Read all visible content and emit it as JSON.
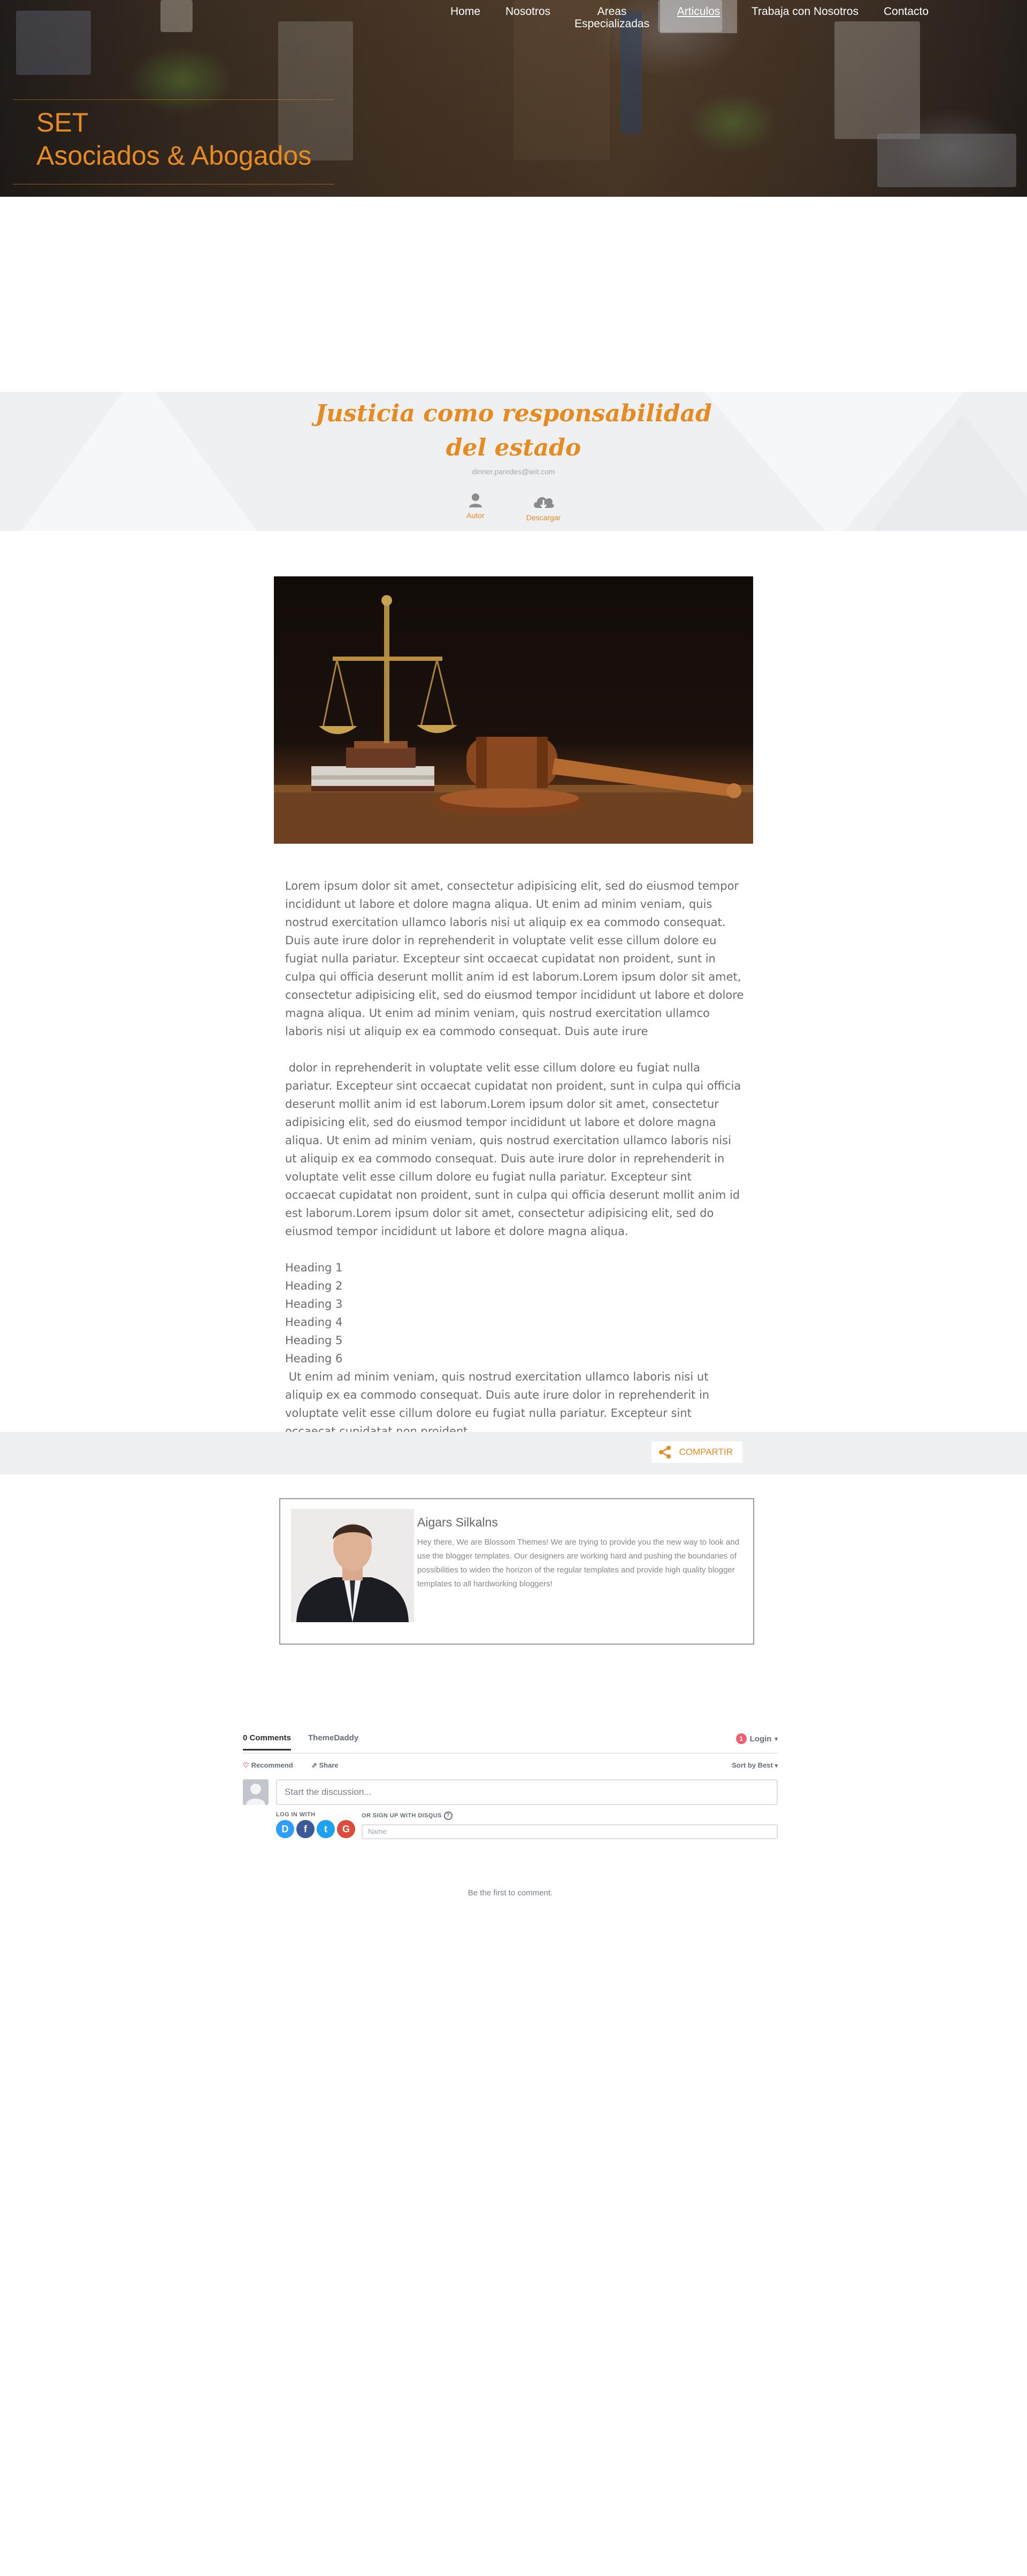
{
  "brand": {
    "line1": "SET",
    "line2": "Asociados & Abogados"
  },
  "nav": {
    "home": "Home",
    "about": "Nosotros",
    "areas_line1": "Areas",
    "areas_line2": "Especializadas",
    "articles": "Articulos",
    "careers": "Trabaja con Nosotros",
    "contact": "Contacto"
  },
  "post": {
    "title_line1": "Justicia como responsabilidad",
    "title_line2": "del estado",
    "email": "dinner.paredes@ieit.com",
    "author_label": "Autor",
    "download_label": "Descargar",
    "image_icon": "scales-and-gavel-photo"
  },
  "article": {
    "p1": "Lorem ipsum dolor sit amet, consectetur adipisicing elit, sed do eiusmod tempor incididunt ut labore et dolore magna aliqua. Ut enim ad minim veniam, quis nostrud exercitation ullamco laboris nisi ut aliquip ex ea commodo consequat. Duis aute irure dolor in reprehenderit in voluptate velit esse cillum dolore eu fugiat nulla pariatur. Excepteur sint occaecat cupidatat non proident, sunt in culpa qui officia deserunt mollit anim id est laborum.Lorem ipsum dolor sit amet, consectetur adipisicing elit, sed do eiusmod tempor incididunt ut labore et dolore magna aliqua. Ut enim ad minim veniam, quis nostrud exercitation ullamco laboris nisi ut aliquip ex ea commodo consequat. Duis aute irure",
    "p2": " dolor in reprehenderit in voluptate velit esse cillum dolore eu fugiat nulla pariatur. Excepteur sint occaecat cupidatat non proident, sunt in culpa qui officia deserunt mollit anim id est laborum.Lorem ipsum dolor sit amet, consectetur adipisicing elit, sed do eiusmod tempor incididunt ut labore et dolore magna aliqua. Ut enim ad minim veniam, quis nostrud exercitation ullamco laboris nisi ut aliquip ex ea commodo consequat. Duis aute irure dolor in reprehenderit in voluptate velit esse cillum dolore eu fugiat nulla pariatur. Excepteur sint occaecat cupidatat non proident, sunt in culpa qui officia deserunt mollit anim id est laborum.Lorem ipsum dolor sit amet, consectetur adipisicing elit, sed do eiusmod tempor incididunt ut labore et dolore magna aliqua.",
    "headings": [
      "Heading 1",
      "Heading 2",
      "Heading 3",
      "Heading 4",
      "Heading 5",
      "Heading 6"
    ],
    "p3": " Ut enim ad minim veniam, quis nostrud exercitation ullamco laboris nisi ut aliquip ex ea commodo consequat. Duis aute irure dolor in reprehenderit in voluptate velit esse cillum dolore eu fugiat nulla pariatur. Excepteur sint occaecat cupidatat non proident,"
  },
  "share": {
    "label": "COMPARTIR"
  },
  "author": {
    "name": "Aigars Silkalns",
    "bio": "Hey there, We are Blossom Themes! We are trying to provide you the new way to look and use the blogger templates. Our designers are working hard and pushing the boundaries of possibilities to widen the horizon of the regular templates and provide high quality blogger templates to all hardworking bloggers!"
  },
  "disqus": {
    "comments_tab": "0 Comments",
    "site_tab": "ThemeDaddy",
    "login_badge": "1",
    "login_label": "Login",
    "recommend_label": "Recommend",
    "share_label": "Share",
    "sort_label": "Sort by Best",
    "input_placeholder": "Start the discussion...",
    "login_with_label": "LOG IN WITH",
    "signup_label": "OR SIGN UP WITH DISQUS",
    "name_placeholder": "Name",
    "empty_message": "Be the first to comment.",
    "social": [
      {
        "letter": "D",
        "color": "#2e9fff"
      },
      {
        "letter": "f",
        "color": "#3b5998"
      },
      {
        "letter": "t",
        "color": "#1da1f2"
      },
      {
        "letter": "G",
        "color": "#dd4b39"
      }
    ]
  },
  "colors": {
    "accent": "#e78a1f",
    "banner_bg": "#eef0f2",
    "text": "#6b6b6b"
  }
}
